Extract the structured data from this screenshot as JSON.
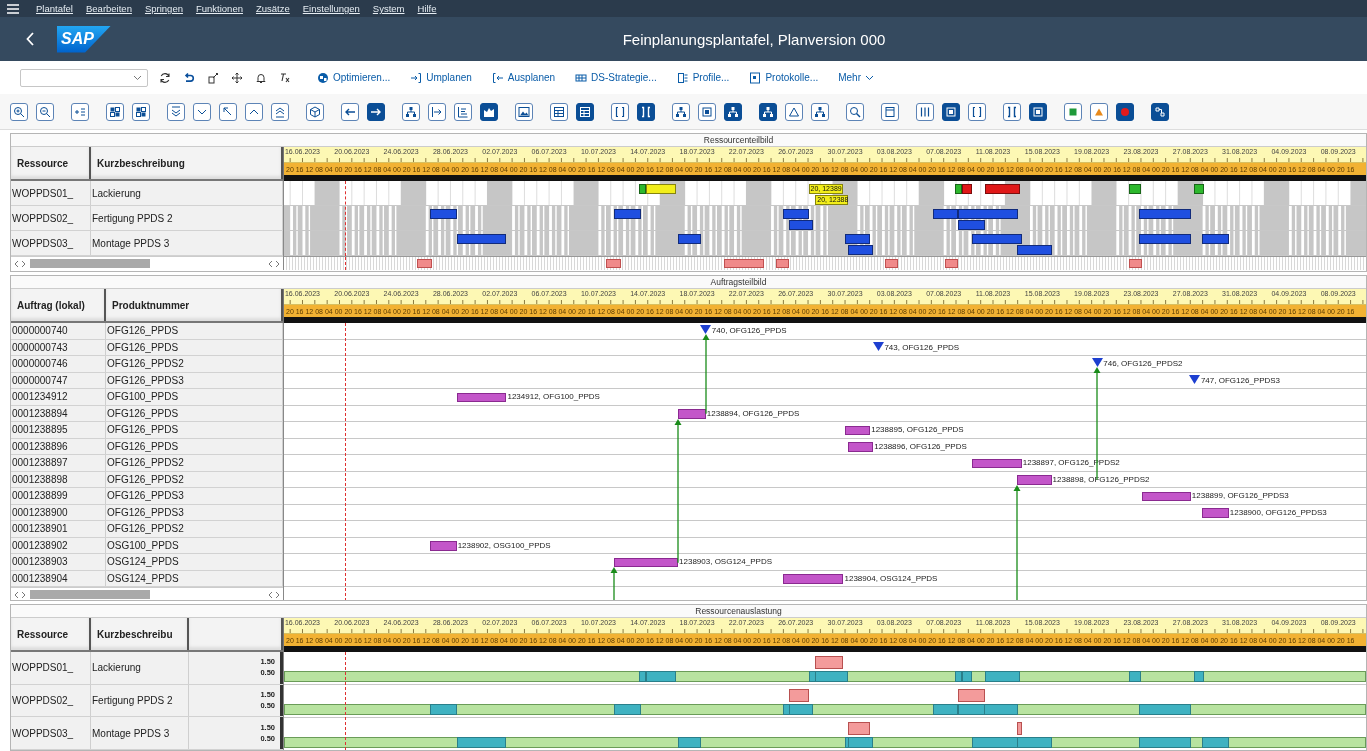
{
  "menu": [
    "Plantafel",
    "Bearbeiten",
    "Springen",
    "Funktionen",
    "Zusätze",
    "Einstellungen",
    "System",
    "Hilfe"
  ],
  "shell": {
    "logo": "SAP",
    "title": "Feinplanungsplantafel, Planversion 000"
  },
  "toolbar": {
    "buttons": [
      "Optimieren...",
      "Umplanen",
      "Ausplanen",
      "DS-Strategie...",
      "Profile...",
      "Protokolle..."
    ],
    "more": "Mehr"
  },
  "icon_groups": [
    [
      {
        "selected": false
      },
      {
        "selected": false
      }
    ],
    [
      {
        "selected": false
      }
    ],
    [
      {
        "selected": false
      },
      {
        "selected": false
      }
    ],
    [
      {
        "selected": false
      },
      {
        "selected": false
      },
      {
        "selected": false
      },
      {
        "selected": false
      },
      {
        "selected": false
      }
    ],
    [
      {
        "selected": false
      }
    ],
    [
      {
        "selected": false
      },
      {
        "selected": true
      }
    ],
    [
      {
        "selected": false
      },
      {
        "selected": false
      },
      {
        "selected": false
      },
      {
        "selected": true
      }
    ],
    [
      {
        "selected": false
      }
    ],
    [
      {
        "selected": false
      },
      {
        "selected": true
      }
    ],
    [
      {
        "selected": false
      },
      {
        "selected": true
      }
    ],
    [
      {
        "selected": false
      },
      {
        "selected": false
      },
      {
        "selected": true
      }
    ],
    [
      {
        "selected": true
      },
      {
        "selected": false
      },
      {
        "selected": false
      }
    ],
    [
      {
        "selected": false
      }
    ],
    [
      {
        "selected": false
      }
    ],
    [
      {
        "selected": false
      },
      {
        "selected": true
      },
      {
        "selected": false
      }
    ],
    [
      {
        "selected": false
      },
      {
        "selected": true
      }
    ],
    [
      {
        "selected": false
      },
      {
        "selected": false
      },
      {
        "selected": true
      }
    ],
    [
      {
        "selected": true
      }
    ]
  ],
  "panels": [
    {
      "kind": "resources",
      "title": "Ressourcenteilbild",
      "columns": [
        "Ressource",
        "Kurzbeschreibung"
      ],
      "timeline": {
        "dates": [
          "16.06.2023",
          "20.06.2023",
          "24.06.2023",
          "28.06.2023",
          "02.07.2023",
          "06.07.2023",
          "10.07.2023",
          "14.07.2023",
          "18.07.2023",
          "22.07.2023",
          "26.07.2023",
          "30.07.2023",
          "03.08.2023",
          "07.08.2023",
          "11.08.2023",
          "15.08.2023",
          "19.08.2023",
          "23.08.2023",
          "27.08.2023",
          "31.08.2023",
          "04.09.2023",
          "08.09.2023"
        ],
        "hours": "20 16 12 08 04 00 20 16 12 08 04 00 20 16 12 08 04 00 20 16 12 08 04 00 20 16 12 08 04 00 20 16 12 08 04 00 20 16 12 08 04 00 20 16 12 08 04 00 20 16 12 08 04 00 20 16 12 08 04 00 20 16 12 08 04 00 20 16 12 08 04 00 20 16 12 08 04 00 20 16 12 08 04 00 20 16 12 08 04 00 20 16 12 08 04 00 20 16 12 08 04 00 20 16 12 08 04 00 20 16"
      },
      "rows": [
        {
          "resource": "WOPPDS01_",
          "description": "Lackierung",
          "kind": "weekends",
          "bars": [
            {
              "kind": "top",
              "color": "#2db82d"
            },
            {
              "kind": "top",
              "color": "#f2ee1a"
            },
            {
              "kind": "top",
              "color": "#f2ee1a",
              "label": "20, 12389"
            },
            {
              "kind": "bottom",
              "color": "#f2ee1a",
              "label": "20, 12388"
            },
            {
              "kind": "top",
              "color": "#2db82d"
            },
            {
              "kind": "top",
              "color": "#e01818"
            },
            {
              "kind": "top",
              "color": "#e01818"
            },
            {
              "kind": "top",
              "color": "#2db82d"
            },
            {
              "kind": "top",
              "color": "#2db82d"
            }
          ]
        },
        {
          "resource": "WOPPDS02_",
          "description": "Fertigung PPDS 2",
          "kind": "shifts",
          "bars": [
            {
              "kind": "top",
              "color": "#1f4fe0"
            },
            {
              "kind": "top",
              "color": "#1f4fe0"
            },
            {
              "kind": "top",
              "color": "#1f4fe0"
            },
            {
              "kind": "bottom",
              "color": "#1f4fe0"
            },
            {
              "kind": "top",
              "color": "#1f4fe0"
            },
            {
              "kind": "top",
              "color": "#1f4fe0"
            },
            {
              "kind": "bottom",
              "color": "#1f4fe0"
            },
            {
              "kind": "top",
              "color": "#1f4fe0"
            }
          ]
        },
        {
          "resource": "WOPPDS03_",
          "description": "Montage PPDS 3",
          "kind": "shifts",
          "bars": [
            {
              "kind": "top",
              "color": "#1f4fe0"
            },
            {
              "kind": "top",
              "color": "#1f4fe0"
            },
            {
              "kind": "top",
              "color": "#1f4fe0"
            },
            {
              "kind": "bottom",
              "color": "#1f4fe0"
            },
            {
              "kind": "top",
              "color": "#1f4fe0"
            },
            {
              "kind": "bottom",
              "color": "#1f4fe0"
            },
            {
              "kind": "top",
              "color": "#1f4fe0"
            },
            {
              "kind": "top",
              "color": "#1f4fe0"
            }
          ]
        }
      ]
    },
    {
      "kind": "orders",
      "title": "Auftragsteilbild",
      "columns": [
        "Auftrag (lokal)",
        "Produktnummer"
      ],
      "timeline": {
        "dates": [
          "16.06.2023",
          "20.06.2023",
          "24.06.2023",
          "28.06.2023",
          "02.07.2023",
          "06.07.2023",
          "10.07.2023",
          "14.07.2023",
          "18.07.2023",
          "22.07.2023",
          "26.07.2023",
          "30.07.2023",
          "03.08.2023",
          "07.08.2023",
          "11.08.2023",
          "15.08.2023",
          "19.08.2023",
          "23.08.2023",
          "27.08.2023",
          "31.08.2023",
          "04.09.2023",
          "08.09.2023"
        ],
        "hours": "20 16 12 08 04 00 20 16 12 08 04 00 20 16 12 08 04 00 20 16 12 08 04 00 20 16 12 08 04 00 20 16 12 08 04 00 20 16 12 08 04 00 20 16 12 08 04 00 20 16 12 08 04 00 20 16 12 08 04 00 20 16 12 08 04 00 20 16 12 08 04 00 20 16 12 08 04 00 20 16 12 08 04 00 20 16 12 08 04 00 20 16 12 08 04 00 20 16 12 08 04 00 20 16 12 08 04 00 20 16"
      },
      "rows": [
        {
          "order": "0000000740",
          "product": "OFG126_PPDS",
          "item": {
            "kind": "milestone",
            "label": "740, OFG126_PPDS"
          }
        },
        {
          "order": "0000000743",
          "product": "OFG126_PPDS",
          "item": {
            "kind": "milestone",
            "label": "743, OFG126_PPDS"
          }
        },
        {
          "order": "0000000746",
          "product": "OFG126_PPDS2",
          "item": {
            "kind": "milestone",
            "label": "746, OFG126_PPDS2"
          }
        },
        {
          "order": "0000000747",
          "product": "OFG126_PPDS3",
          "item": {
            "kind": "milestone",
            "label": "747, OFG126_PPDS3"
          }
        },
        {
          "order": "0001234912",
          "product": "OFG100_PPDS",
          "item": {
            "kind": "bar",
            "label": "1234912, OFG100_PPDS"
          }
        },
        {
          "order": "0001238894",
          "product": "OFG126_PPDS",
          "item": {
            "kind": "bar",
            "label": "1238894, OFG126_PPDS"
          }
        },
        {
          "order": "0001238895",
          "product": "OFG126_PPDS",
          "item": {
            "kind": "bar",
            "label": "1238895, OFG126_PPDS"
          }
        },
        {
          "order": "0001238896",
          "product": "OFG126_PPDS",
          "item": {
            "kind": "bar",
            "label": "1238896, OFG126_PPDS"
          }
        },
        {
          "order": "0001238897",
          "product": "OFG126_PPDS2",
          "item": {
            "kind": "bar",
            "label": "1238897, OFG126_PPDS2"
          }
        },
        {
          "order": "0001238898",
          "product": "OFG126_PPDS2",
          "item": {
            "kind": "bar",
            "label": "1238898, OFG126_PPDS2"
          }
        },
        {
          "order": "0001238899",
          "product": "OFG126_PPDS3",
          "item": {
            "kind": "bar",
            "label": "1238899, OFG126_PPDS3"
          }
        },
        {
          "order": "0001238900",
          "product": "OFG126_PPDS3",
          "item": {
            "kind": "bar",
            "label": "1238900, OFG126_PPDS3"
          }
        },
        {
          "order": "0001238901",
          "product": "OFG126_PPDS2"
        },
        {
          "order": "0001238902",
          "product": "OSG100_PPDS",
          "item": {
            "kind": "bar",
            "label": "1238902, OSG100_PPDS"
          }
        },
        {
          "order": "0001238903",
          "product": "OSG124_PPDS",
          "item": {
            "kind": "bar",
            "label": "1238903, OSG124_PPDS"
          }
        },
        {
          "order": "0001238904",
          "product": "OSG124_PPDS",
          "item": {
            "kind": "bar",
            "label": "1238904, OSG124_PPDS"
          }
        }
      ]
    },
    {
      "kind": "load",
      "title": "Ressourcenauslastung",
      "columns": [
        "Ressource",
        "Kurzbeschreibu"
      ],
      "timeline": {
        "dates": [
          "16.06.2023",
          "20.06.2023",
          "24.06.2023",
          "28.06.2023",
          "02.07.2023",
          "06.07.2023",
          "10.07.2023",
          "14.07.2023",
          "18.07.2023",
          "22.07.2023",
          "26.07.2023",
          "30.07.2023",
          "03.08.2023",
          "07.08.2023",
          "11.08.2023",
          "15.08.2023",
          "19.08.2023",
          "23.08.2023",
          "27.08.2023",
          "31.08.2023",
          "04.09.2023",
          "08.09.2023"
        ],
        "hours": "20 16 12 08 04 00 20 16 12 08 04 00 20 16 12 08 04 00 20 16 12 08 04 00 20 16 12 08 04 00 20 16 12 08 04 00 20 16 12 08 04 00 20 16 12 08 04 00 20 16 12 08 04 00 20 16 12 08 04 00 20 16 12 08 04 00 20 16 12 08 04 00 20 16 12 08 04 00 20 16 12 08 04 00 20 16 12 08 04 00 20 16 12 08 04 00 20 16 12 08 04 00 20 16 12 08 04 00 20 16"
      },
      "rows": [
        {
          "resource": "WOPPDS01_",
          "description": "Lackierung",
          "scale": [
            "1.50",
            "0.50"
          ]
        },
        {
          "resource": "WOPPDS02_",
          "description": "Fertigung PPDS 2",
          "scale": [
            "1.50",
            "0.50"
          ]
        },
        {
          "resource": "WOPPDS03_",
          "description": "Montage PPDS 3",
          "scale": [
            "1.50",
            "0.50"
          ]
        }
      ]
    }
  ]
}
